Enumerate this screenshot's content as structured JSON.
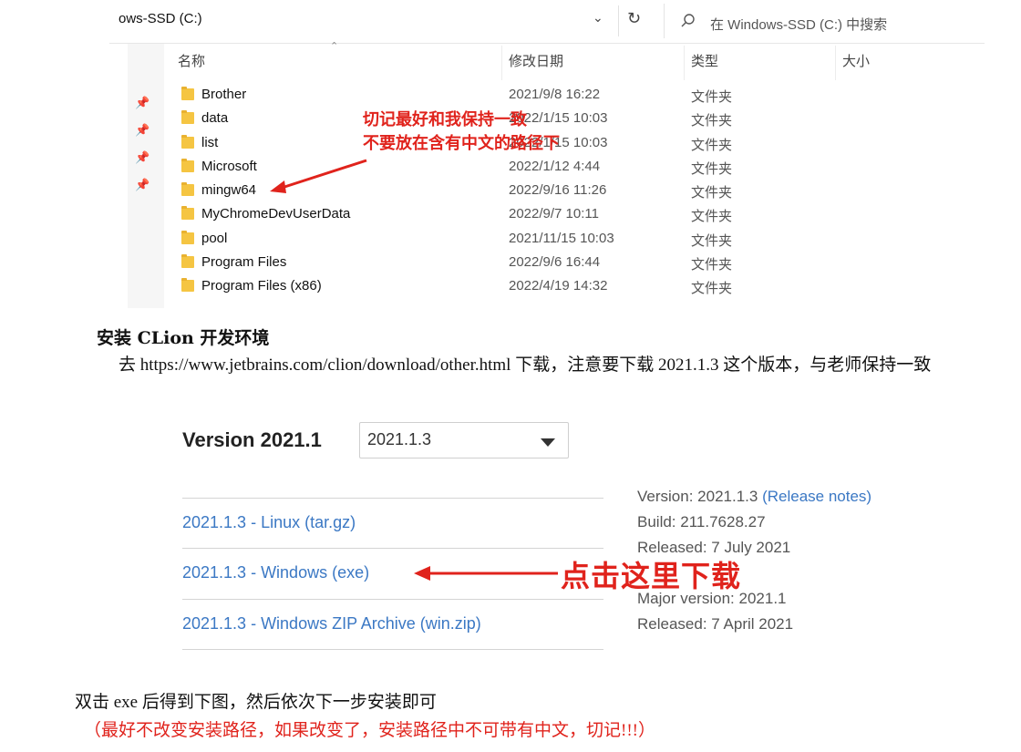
{
  "explorer": {
    "address": "ows-SSD (C:)",
    "search_placeholder": "在 Windows-SSD (C:) 中搜索",
    "columns": {
      "name": "名称",
      "date": "修改日期",
      "type": "类型",
      "size": "大小"
    },
    "rows": [
      {
        "name": "Brother",
        "date": "2021/9/8 16:22",
        "type": "文件夹"
      },
      {
        "name": "data",
        "date": "2022/1/15 10:03",
        "type": "文件夹"
      },
      {
        "name": "list",
        "date": "2022/1/15 10:03",
        "type": "文件夹"
      },
      {
        "name": "Microsoft",
        "date": "2022/1/12 4:44",
        "type": "文件夹"
      },
      {
        "name": "mingw64",
        "date": "2022/9/16 11:26",
        "type": "文件夹"
      },
      {
        "name": "MyChromeDevUserData",
        "date": "2022/9/7 10:11",
        "type": "文件夹"
      },
      {
        "name": "pool",
        "date": "2021/11/15 10:03",
        "type": "文件夹"
      },
      {
        "name": "Program Files",
        "date": "2022/9/6 16:44",
        "type": "文件夹"
      },
      {
        "name": "Program Files (x86)",
        "date": "2022/4/19 14:32",
        "type": "文件夹"
      }
    ],
    "annotation": [
      "切记最好和我保持一致",
      "不要放在含有中文的路径下"
    ]
  },
  "section_title": "安装 CLion 开发环境",
  "paragraph": "去 https://www.jetbrains.com/clion/download/other.html 下载，注意要下载 2021.1.3 这个版本，与老师保持一致",
  "download": {
    "version_label": "Version 2021.1",
    "selected_version": "2021.1.3",
    "links": [
      "2021.1.3 - Linux (tar.gz)",
      "2021.1.3 - Windows (exe)",
      "2021.1.3 - Windows ZIP Archive (win.zip)"
    ],
    "info": {
      "version_key": "Version:",
      "version_val": "2021.1.3",
      "notes": "(Release notes)",
      "build_key": "Build:",
      "build_val": "211.7628.27",
      "released_key": "Released:",
      "released_val": "7 July 2021",
      "major_key": "Major version:",
      "major_val": "2021.1",
      "released2_key": "Released:",
      "released2_val": "7 April 2021"
    },
    "annotation": "点击这里下载"
  },
  "after_text": "双击 exe 后得到下图，然后依次下一步安装即可",
  "warning_text": "（最好不改变安装路径，如果改变了，安装路径中不可带有中文，切记!!!）",
  "colors": {
    "annotation_red": "#e0231c",
    "link_blue": "#3b78c4",
    "folder_yellow": "#f5c542"
  }
}
